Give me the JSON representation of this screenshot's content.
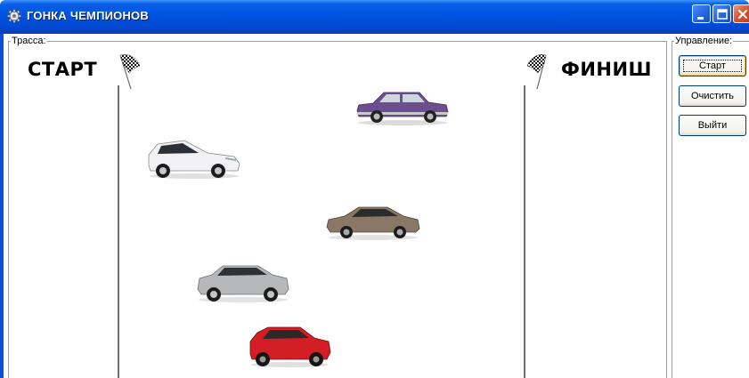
{
  "window": {
    "title": "ГОНКА ЧЕМПИОНОВ",
    "icon": "gear-icon",
    "controls": [
      "minimize-icon",
      "maximize-icon",
      "close-icon"
    ]
  },
  "track": {
    "legend": "Трасса:",
    "start_label": "СТАРТ",
    "finish_label": "ФИНИШ",
    "cars": [
      {
        "name": "purple-sedan",
        "color": "#6b4f8f"
      },
      {
        "name": "white-hatchback",
        "color": "#e8e8ea"
      },
      {
        "name": "bronze-sedan",
        "color": "#8a7866"
      },
      {
        "name": "silver-suv",
        "color": "#b7b8ba"
      },
      {
        "name": "red-compact",
        "color": "#d21e24"
      }
    ]
  },
  "controls": {
    "legend": "Управление:",
    "start_button": "Старт",
    "clear_button": "Очистить",
    "exit_button": "Выйти"
  },
  "colors": {
    "titlebar": "#0054e3",
    "close_button": "#d7532f"
  }
}
